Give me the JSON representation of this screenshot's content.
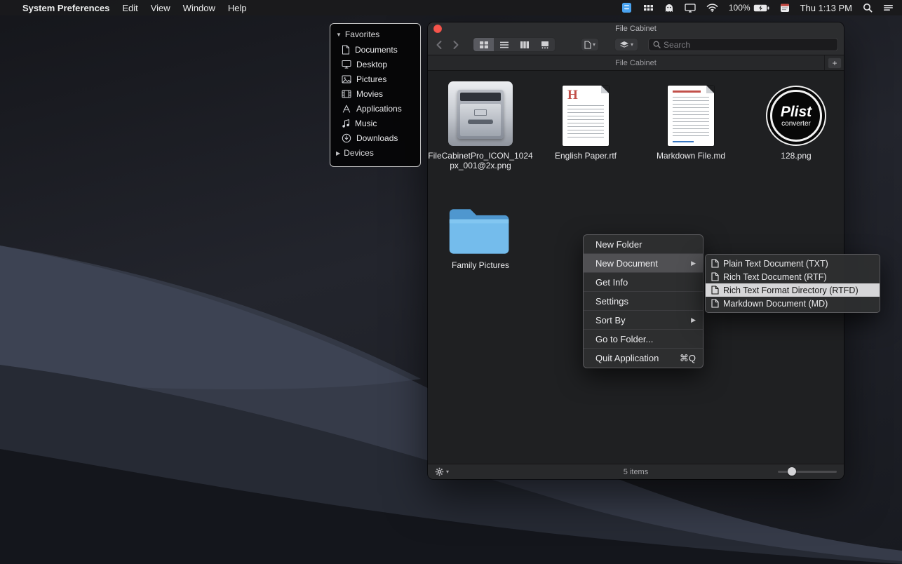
{
  "menubar": {
    "apple_logo": "",
    "app_name": "System Preferences",
    "menus": [
      "Edit",
      "View",
      "Window",
      "Help"
    ],
    "battery_percent": "100%",
    "clock": "Thu 1:13 PM",
    "status_icons": [
      "file-cabinet-app-icon",
      "grid-icon",
      "ghost-icon",
      "display-icon",
      "wifi-icon",
      "battery-icon",
      "calendar-icon",
      "spotlight-search-icon",
      "notification-center-icon"
    ]
  },
  "sidebar": {
    "favorites_label": "Favorites",
    "devices_label": "Devices",
    "items": [
      {
        "label": "Documents",
        "icon": "document-icon"
      },
      {
        "label": "Desktop",
        "icon": "desktop-icon"
      },
      {
        "label": "Pictures",
        "icon": "pictures-icon"
      },
      {
        "label": "Movies",
        "icon": "movies-icon"
      },
      {
        "label": "Applications",
        "icon": "applications-icon"
      },
      {
        "label": "Music",
        "icon": "music-icon"
      },
      {
        "label": "Downloads",
        "icon": "downloads-icon"
      }
    ]
  },
  "window": {
    "title": "File Cabinet",
    "header_title": "File Cabinet",
    "add_label": "+",
    "search_placeholder": "Search",
    "status_text": "5 items",
    "files": [
      {
        "name": "FileCabinetPro_ICON_1024px_001@2x.png",
        "kind": "image"
      },
      {
        "name": "English Paper.rtf",
        "kind": "rtf-document",
        "preview_letter": "H"
      },
      {
        "name": "Markdown File.md",
        "kind": "markdown-document"
      },
      {
        "name": "128.png",
        "kind": "image",
        "icon_text_top": "Plist",
        "icon_text_bottom": "converter"
      },
      {
        "name": "Family Pictures",
        "kind": "folder"
      }
    ]
  },
  "context_menu": {
    "items": [
      {
        "label": "New Folder"
      },
      {
        "label": "New Document",
        "has_submenu": true,
        "highlighted": true
      },
      {
        "label": "Get Info"
      },
      {
        "label": "Settings"
      },
      {
        "label": "Sort By",
        "has_submenu": true
      },
      {
        "label": "Go to Folder..."
      },
      {
        "label": "Quit Application",
        "shortcut": "⌘Q"
      }
    ]
  },
  "submenu": {
    "items": [
      {
        "label": "Plain Text Document (TXT)"
      },
      {
        "label": "Rich Text Document (RTF)"
      },
      {
        "label": "Rich Text Format Directory (RTFD)",
        "highlighted": true
      },
      {
        "label": "Markdown Document (MD)"
      }
    ]
  },
  "colors": {
    "menu_highlight": "#505053",
    "submenu_highlight": "#d6d6d8",
    "folder_blue": "#6fb6e8",
    "close_button_red": "#f5554c"
  }
}
